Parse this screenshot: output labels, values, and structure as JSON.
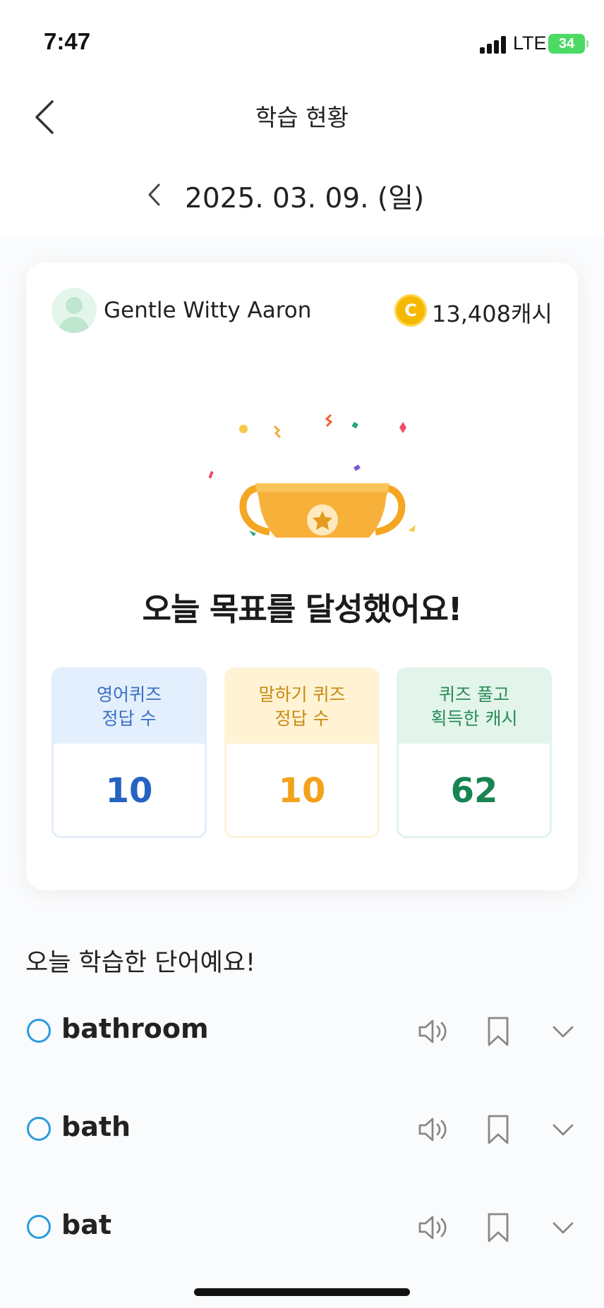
{
  "status_bar": {
    "time": "7:47",
    "network": "LTE",
    "battery": "34"
  },
  "header": {
    "title": "학습 현황"
  },
  "date": {
    "label": "2025. 03. 09. (일)"
  },
  "summary": {
    "user_name": "Gentle Witty Aaron",
    "cash": "13,408캐시",
    "coin_symbol": "C",
    "headline": "오늘 목표를 달성했어요!",
    "stats": [
      {
        "line1": "영어퀴즈",
        "line2": "정답 수",
        "value": "10",
        "color": "#2563c2"
      },
      {
        "line1": "말하기 퀴즈",
        "line2": "정답 수",
        "value": "10",
        "color": "#f3a21b"
      },
      {
        "line1": "퀴즈 풀고",
        "line2": "획득한 캐시",
        "value": "62",
        "color": "#188452"
      }
    ]
  },
  "words_section": {
    "title": "오늘 학습한 단어예요!",
    "words": [
      {
        "word": "bathroom",
        "speaker_icon": "speaker-icon",
        "bookmark_icon": "bookmark-icon",
        "expand_icon": "chevron-down-icon"
      },
      {
        "word": "bath",
        "speaker_icon": "speaker-icon",
        "bookmark_icon": "bookmark-icon",
        "expand_icon": "chevron-down-icon"
      },
      {
        "word": "bat",
        "speaker_icon": "speaker-icon",
        "bookmark_icon": "bookmark-icon",
        "expand_icon": "chevron-down-icon"
      }
    ]
  },
  "colors": {
    "accent_blue": "#2a9be0",
    "trophy": "#f5a623",
    "battery": "#4cd964"
  }
}
